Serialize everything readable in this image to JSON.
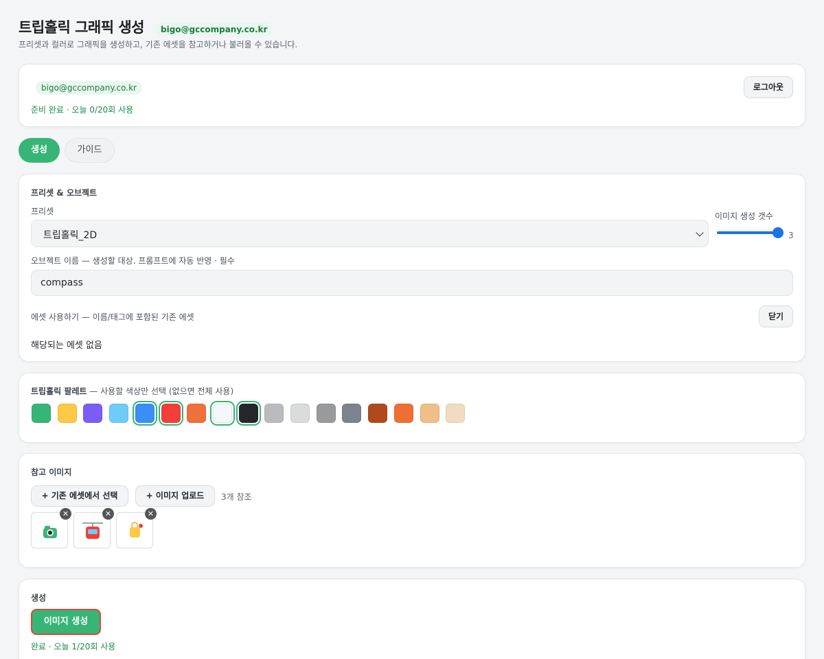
{
  "header": {
    "title": "트립홀릭 그래픽 생성",
    "email": "bigo@gccompany.co.kr",
    "subtitle": "프리셋과 컬러로 그래픽을 생성하고, 기존 에셋을 참고하거나 불러올 수 있습니다."
  },
  "account": {
    "email": "bigo@gccompany.co.kr",
    "status": "준비 완료 · 오늘 0/20회 사용",
    "logout_label": "로그아웃"
  },
  "tabs": [
    {
      "label": "생성",
      "active": true
    },
    {
      "label": "가이드",
      "active": false
    }
  ],
  "preset_section": {
    "title": "프리셋 & 오브젝트",
    "preset_label": "프리셋",
    "preset_value": "트립홀릭_2D",
    "count_label": "이미지 생성 갯수",
    "count_value": "3",
    "count_fraction": 1.0,
    "object_label": "오브젝트 이름 — 생성할 대상. 프롬프트에 자동 반영 · 필수",
    "object_value": "compass",
    "asset_label": "에셋 사용하기 — 이름/태그에 포함된 기존 에셋",
    "close_label": "닫기",
    "no_asset_text": "해당되는 에셋 없음"
  },
  "palette": {
    "title": "트립홀릭 팔레트",
    "hint": " — 사용할 색상만 선택 (없으면 전체 사용)",
    "colors": [
      {
        "hex": "#37b576",
        "selected": false
      },
      {
        "hex": "#ffc845",
        "selected": false
      },
      {
        "hex": "#7b5cf6",
        "selected": false
      },
      {
        "hex": "#6fcbf7",
        "selected": false
      },
      {
        "hex": "#3a8ff5",
        "selected": true
      },
      {
        "hex": "#f23f3a",
        "selected": true
      },
      {
        "hex": "#f0703a",
        "selected": false
      },
      {
        "hex": "#f6f7f8",
        "selected": true
      },
      {
        "hex": "#25272c",
        "selected": true
      },
      {
        "hex": "#b9bbbf",
        "selected": false
      },
      {
        "hex": "#d9dcdb",
        "selected": false
      },
      {
        "hex": "#999a9c",
        "selected": false
      },
      {
        "hex": "#7d838d",
        "selected": false
      },
      {
        "hex": "#b04a1c",
        "selected": false
      },
      {
        "hex": "#ef6f33",
        "selected": false
      },
      {
        "hex": "#f0be87",
        "selected": false
      },
      {
        "hex": "#f1dcc2",
        "selected": false
      }
    ]
  },
  "references": {
    "title": "참고 이미지",
    "select_existing_label": "+  기존 에셋에서 선택",
    "upload_label": "+  이미지 업로드",
    "count_text": "3개 참조",
    "remove_glyph": "✕",
    "thumbnails": [
      {
        "icon": "camera-icon"
      },
      {
        "icon": "cable-car-icon"
      },
      {
        "icon": "bag-icon"
      }
    ]
  },
  "generate": {
    "title": "생성",
    "button_label": "이미지 생성",
    "status": "완료 · 오늘 1/20회 사용"
  }
}
